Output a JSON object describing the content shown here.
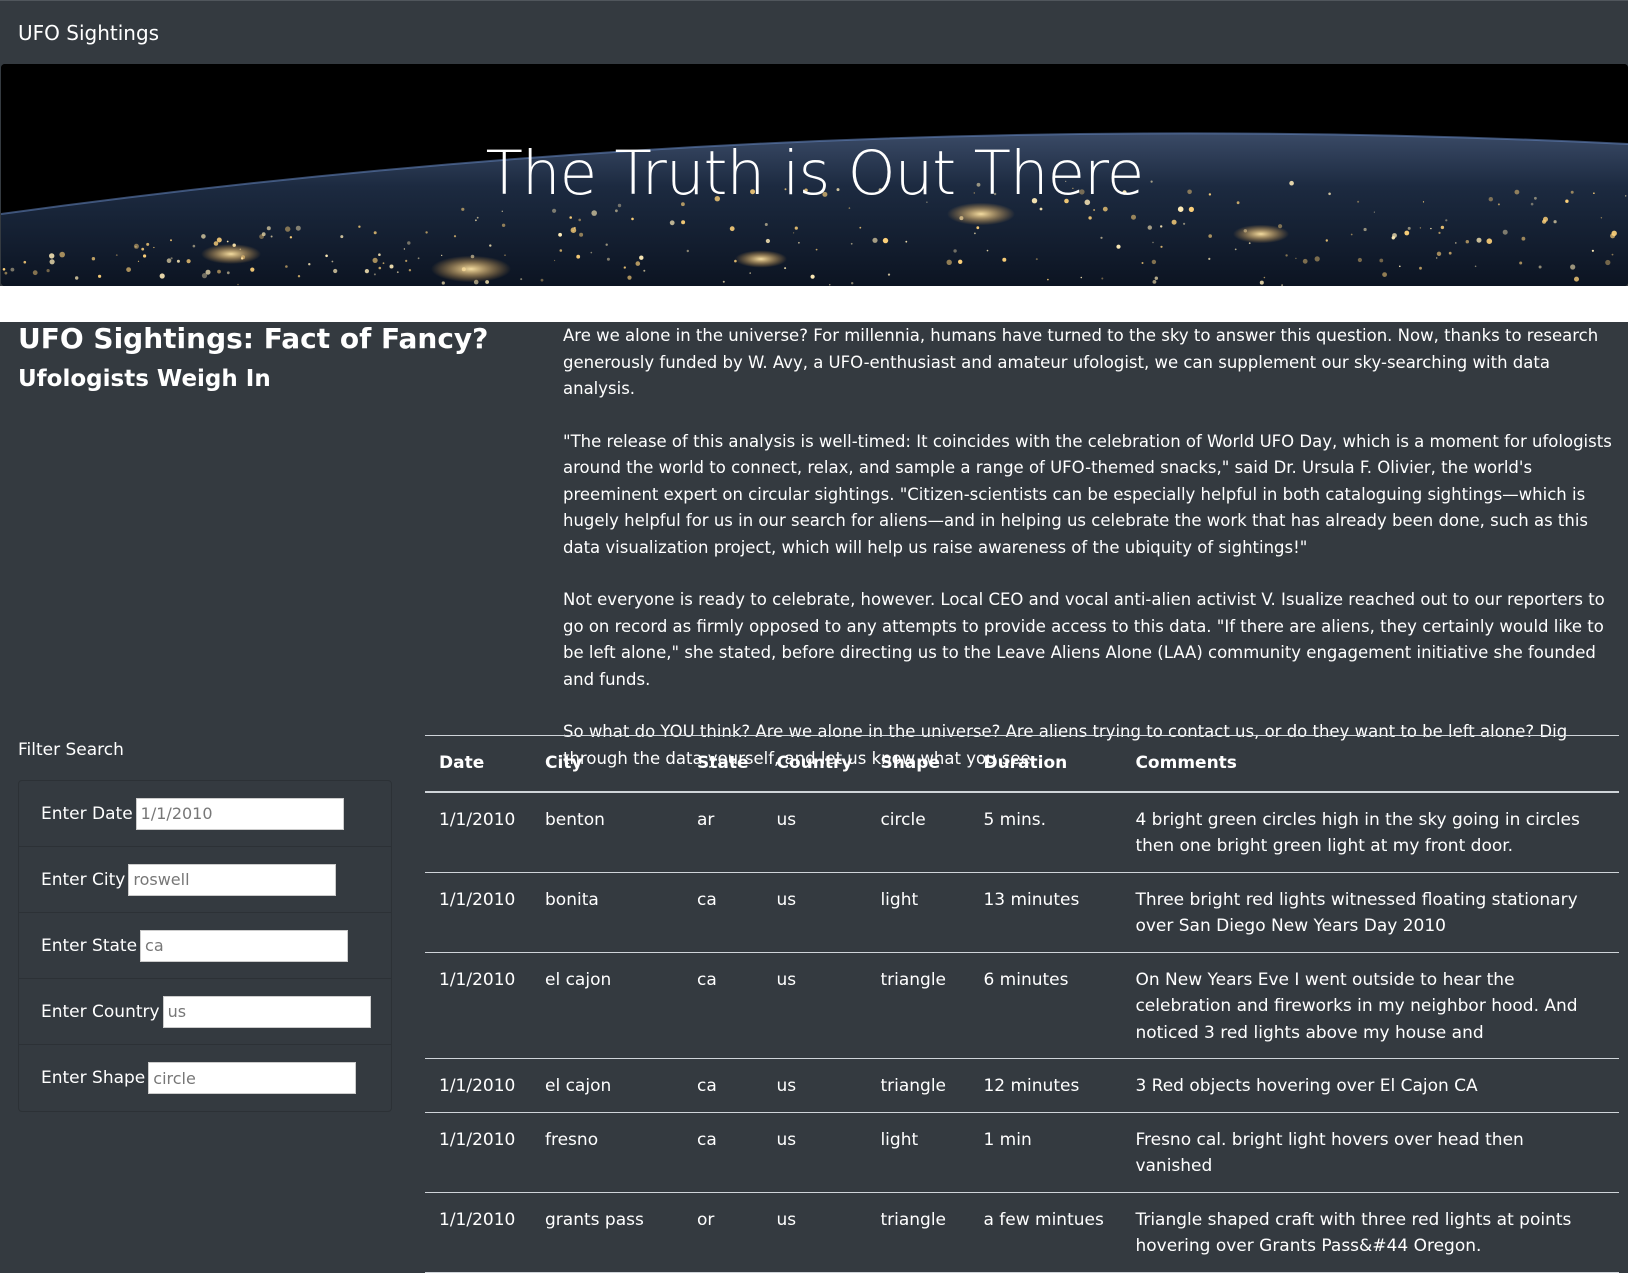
{
  "navbar": {
    "brand": "UFO Sightings"
  },
  "hero": {
    "title": "The Truth is Out There"
  },
  "intro": {
    "headline": "UFO Sightings: Fact of Fancy?",
    "subhead": "Ufologists Weigh In",
    "paragraphs": [
      "Are we alone in the universe? For millennia, humans have turned to the sky to answer this question. Now, thanks to research generously funded by W. Avy, a UFO-enthusiast and amateur ufologist, we can supplement our sky-searching with data analysis.",
      "\"The release of this analysis is well-timed: It coincides with the celebration of World UFO Day, which is a moment for ufologists around the world to connect, relax, and sample a range of UFO-themed snacks,\" said Dr. Ursula F. Olivier, the world's preeminent expert on circular sightings. \"Citizen-scientists can be especially helpful in both cataloguing sightings—which is hugely helpful for us in our search for aliens—and in helping us celebrate the work that has already been done, such as this data visualization project, which will help us raise awareness of the ubiquity of sightings!\"",
      "Not everyone is ready to celebrate, however. Local CEO and vocal anti-alien activist V. Isualize reached out to our reporters to go on record as firmly opposed to any attempts to provide access to this data. \"If there are aliens, they certainly would like to be left alone,\" she stated, before directing us to the Leave Aliens Alone (LAA) community engagement initiative she founded and funds.",
      "So what do YOU think? Are we alone in the universe? Are aliens trying to contact us, or do they want to be left alone? Dig through the data yourself, and let us know what you see."
    ]
  },
  "filters": {
    "title": "Filter Search",
    "date": {
      "label": "Enter Date",
      "placeholder": "1/1/2010"
    },
    "city": {
      "label": "Enter City",
      "placeholder": "roswell"
    },
    "state": {
      "label": "Enter State",
      "placeholder": "ca"
    },
    "country": {
      "label": "Enter Country",
      "placeholder": "us"
    },
    "shape": {
      "label": "Enter Shape",
      "placeholder": "circle"
    }
  },
  "table": {
    "headers": [
      "Date",
      "City",
      "State",
      "Country",
      "Shape",
      "Duration",
      "Comments"
    ],
    "rows": [
      [
        "1/1/2010",
        "benton",
        "ar",
        "us",
        "circle",
        "5 mins.",
        "4 bright green circles high in the sky going in circles then one bright green light at my front door."
      ],
      [
        "1/1/2010",
        "bonita",
        "ca",
        "us",
        "light",
        "13 minutes",
        "Three bright red lights witnessed floating stationary over San Diego New Years Day 2010"
      ],
      [
        "1/1/2010",
        "el cajon",
        "ca",
        "us",
        "triangle",
        "6 minutes",
        "On New Years Eve I went outside to hear the celebration and fireworks in my neighbor hood. And noticed 3 red lights above my house and"
      ],
      [
        "1/1/2010",
        "el cajon",
        "ca",
        "us",
        "triangle",
        "12 minutes",
        "3 Red objects hovering over El Cajon CA"
      ],
      [
        "1/1/2010",
        "fresno",
        "ca",
        "us",
        "light",
        "1 min",
        "Fresno cal. bright light hovers over head then vanished"
      ],
      [
        "1/1/2010",
        "grants pass",
        "or",
        "us",
        "triangle",
        "a few mintues",
        "Triangle shaped craft with three red lights at points hovering over Grants Pass&#44 Oregon."
      ]
    ]
  },
  "colors": {
    "background": "#343a40",
    "hero_background": "#000000",
    "text": "#ffffff",
    "table_border": "#cfd4d9"
  }
}
